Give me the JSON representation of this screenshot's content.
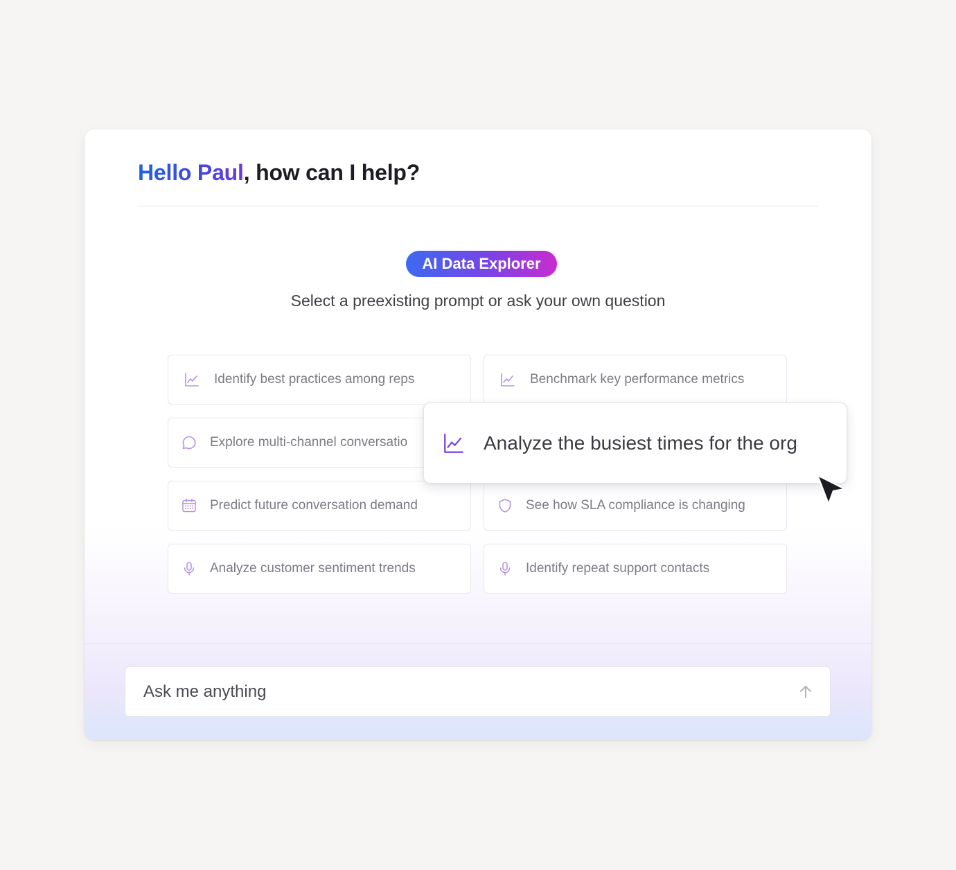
{
  "greeting": {
    "name": "Hello Paul",
    "rest": ", how can I help?"
  },
  "badge": {
    "label": "AI Data Explorer"
  },
  "subtitle": "Select a preexisting prompt or ask your own question",
  "prompts": [
    {
      "label": "Identify best practices among reps",
      "icon": "chart-line-icon"
    },
    {
      "label": "Benchmark key performance metrics",
      "icon": "chart-line-icon"
    },
    {
      "label": "Explore multi-channel conversatio",
      "icon": "chat-bubble-icon"
    },
    {
      "label": "",
      "icon": ""
    },
    {
      "label": "Predict future conversation demand",
      "icon": "calendar-icon"
    },
    {
      "label": "See how SLA compliance is changing",
      "icon": "shield-icon"
    },
    {
      "label": "Analyze customer sentiment trends",
      "icon": "microphone-icon"
    },
    {
      "label": "Identify repeat support contacts",
      "icon": "microphone-icon"
    }
  ],
  "highlighted_prompt": {
    "label": "Analyze the busiest times for the org",
    "icon": "chart-line-icon"
  },
  "ask_input": {
    "placeholder": "Ask me anything",
    "value": ""
  },
  "colors": {
    "brand_blue": "#1d63e6",
    "brand_purple": "#7a43e6",
    "brand_magenta": "#c92ccf",
    "icon_purple": "#b592e8"
  }
}
